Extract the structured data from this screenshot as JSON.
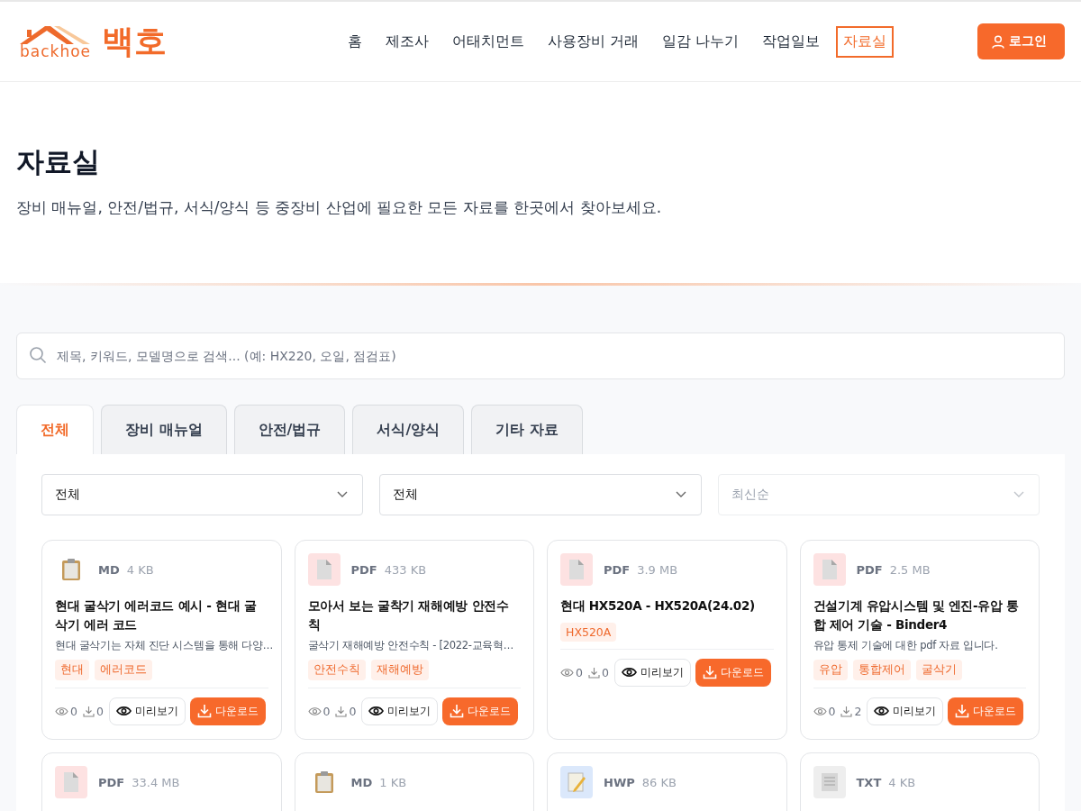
{
  "header": {
    "logo": {
      "wordmark": "backhoe",
      "name": "백호"
    },
    "nav": [
      {
        "label": "홈",
        "selected": false
      },
      {
        "label": "제조사",
        "selected": false
      },
      {
        "label": "어태치먼트",
        "selected": false
      },
      {
        "label": "사용장비 거래",
        "selected": false
      },
      {
        "label": "일감 나누기",
        "selected": false
      },
      {
        "label": "작업일보",
        "selected": false
      },
      {
        "label": "자료실",
        "selected": true
      }
    ],
    "login_button": "로그인"
  },
  "hero": {
    "title": "자료실",
    "subtitle": "장비 매뉴얼, 안전/법규, 서식/양식 등 중장비 산업에 필요한 모든 자료를 한곳에서 찾아보세요."
  },
  "search": {
    "placeholder": "제목, 키워드, 모델명으로 검색... (예: HX220, 오일, 점검표)"
  },
  "tabs": [
    {
      "label": "전체",
      "selected": true
    },
    {
      "label": "장비 매뉴얼",
      "selected": false
    },
    {
      "label": "안전/법규",
      "selected": false
    },
    {
      "label": "서식/양식",
      "selected": false
    },
    {
      "label": "기타 자료",
      "selected": false
    }
  ],
  "filters": [
    {
      "value": "전체",
      "disabled": false
    },
    {
      "value": "전체",
      "disabled": false
    },
    {
      "value": "최신순",
      "disabled": true
    }
  ],
  "cards": [
    {
      "kind": "md",
      "type": "MD",
      "size": "4 KB",
      "title": "현대 굴삭기 에러코드 예시 - 현대 굴삭기 에러 코드",
      "description": "현대 굴삭기는 자체 진단 시스템을 통해 다양…",
      "tags": [
        "현대",
        "에러코드"
      ],
      "views": "0",
      "downloads": "0",
      "preview": "미리보기",
      "download": "다운로드"
    },
    {
      "kind": "pdf",
      "type": "PDF",
      "size": "433 KB",
      "title": "모아서 보는 굴착기 재해예방 안전수칙",
      "description": "굴삭기 재해예방 안전수칙 - [2022-교육혁…",
      "tags": [
        "안전수칙",
        "재해예방"
      ],
      "views": "0",
      "downloads": "0",
      "preview": "미리보기",
      "download": "다운로드"
    },
    {
      "kind": "pdf",
      "type": "PDF",
      "size": "3.9 MB",
      "title": "현대 HX520A - HX520A(24.02)",
      "tags": [
        "HX520A"
      ],
      "views": "0",
      "downloads": "0",
      "preview": "미리보기",
      "download": "다운로드"
    },
    {
      "kind": "pdf",
      "type": "PDF",
      "size": "2.5 MB",
      "title": "건설기계 유압시스템 및 엔진-유압 통합 제어 기술 - Binder4",
      "description": "유압 통제 기술에 대한 pdf 자료 입니다.",
      "tags": [
        "유압",
        "통합제어",
        "굴삭기"
      ],
      "views": "0",
      "downloads": "2",
      "preview": "미리보기",
      "download": "다운로드"
    },
    {
      "kind": "pdf",
      "type": "PDF",
      "size": "33.4 MB"
    },
    {
      "kind": "md",
      "type": "MD",
      "size": "1 KB"
    },
    {
      "kind": "hwp",
      "type": "HWP",
      "size": "86 KB"
    },
    {
      "kind": "txt",
      "type": "TXT",
      "size": "4 KB"
    }
  ]
}
